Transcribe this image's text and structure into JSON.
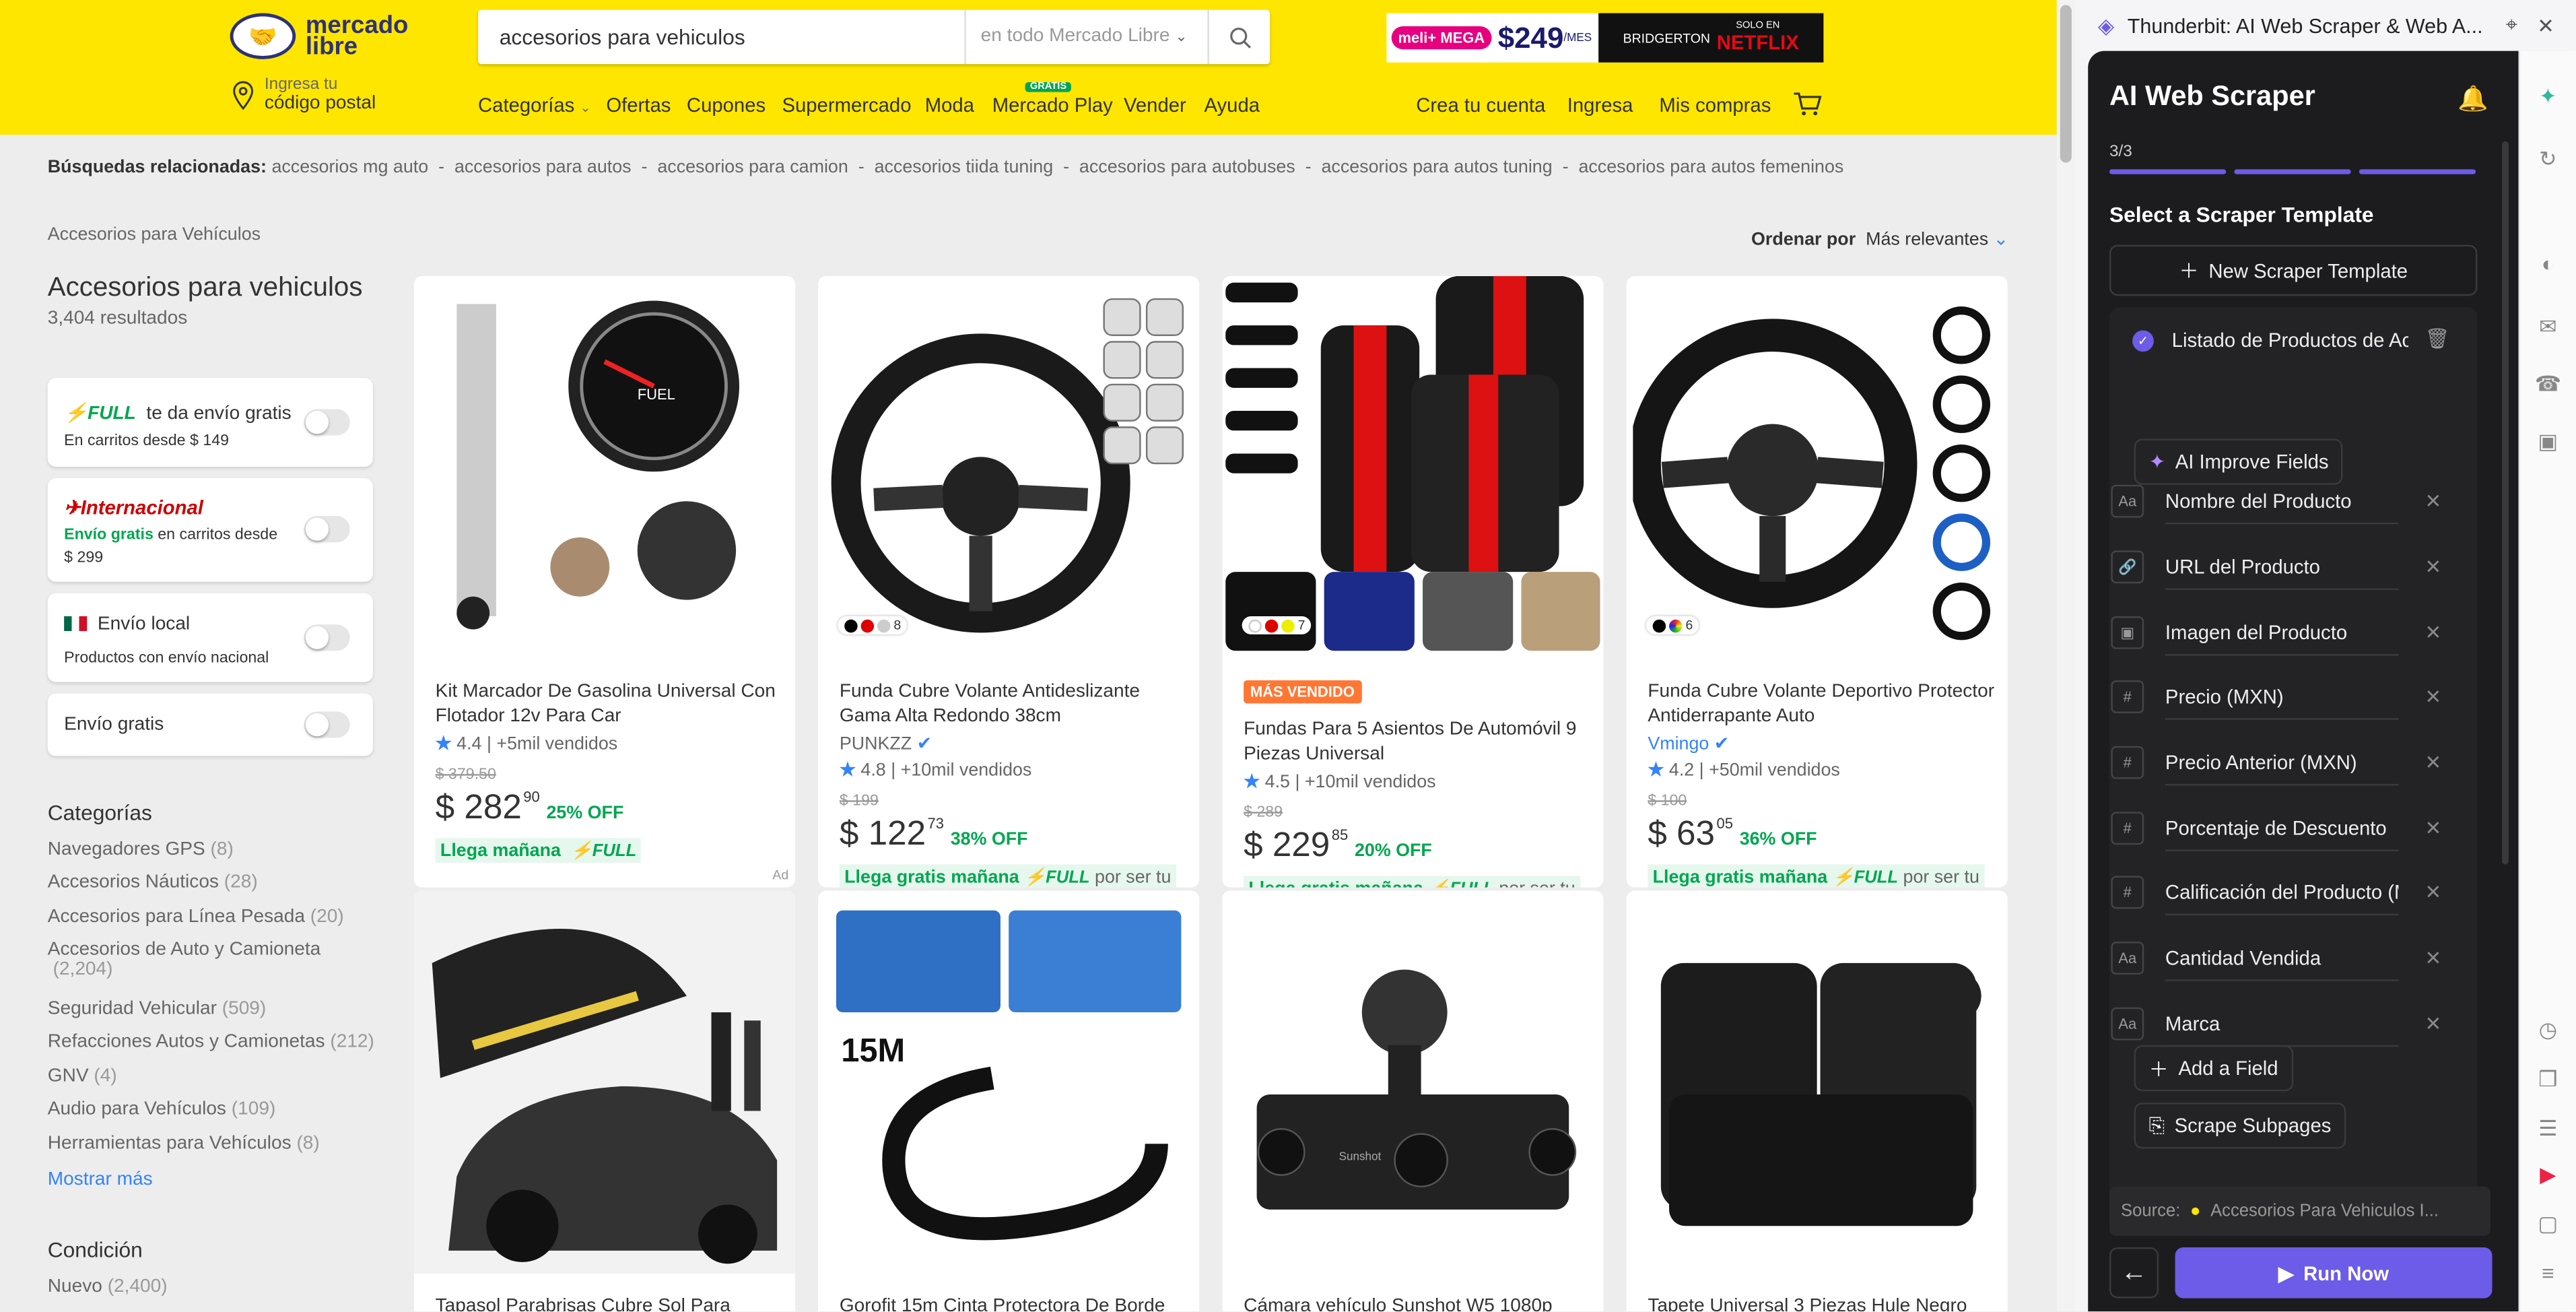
{
  "header": {
    "logo_line1": "mercado",
    "logo_line2": "libre",
    "search_value": "accesorios para vehiculos",
    "search_scope": "en todo Mercado Libre",
    "promo_badge": "meli+ MEGA",
    "promo_price": "$249",
    "promo_unit": "/MES",
    "promo_brand": "BRIDGERTON",
    "promo_solo": "SOLO EN",
    "promo_netflix": "NETFLIX",
    "loc_line1": "Ingresa tu",
    "loc_line2": "código postal",
    "nav": [
      "Categorías",
      "Ofertas",
      "Cupones",
      "Supermercado",
      "Moda",
      "Mercado Play",
      "Vender",
      "Ayuda"
    ],
    "gratis_badge": "GRATIS",
    "account": [
      "Crea tu cuenta",
      "Ingresa",
      "Mis compras"
    ]
  },
  "related": {
    "label": "Búsquedas relacionadas:",
    "items": [
      "accesorios mg auto",
      "accesorios para autos",
      "accesorios para camion",
      "accesorios tiida tuning",
      "accesorios para autobuses",
      "accesorios para autos tuning",
      "accesorios para autos femeninos"
    ]
  },
  "breadcrumb": "Accesorios para Vehículos",
  "sort": {
    "label": "Ordenar por",
    "value": "Más relevantes"
  },
  "results": {
    "title": "Accesorios para vehiculos",
    "count": "3,404 resultados"
  },
  "filters": {
    "full_logo": "FULL",
    "full_text": "te da envío gratis",
    "full_sub": "En carritos desde $ 149",
    "intl_title": "Internacional",
    "intl_green": "Envío gratis",
    "intl_sub": "en carritos desde",
    "intl_amount": "$ 299",
    "local_title": "Envío local",
    "local_sub": "Productos con envío nacional",
    "free_title": "Envío gratis"
  },
  "categories": {
    "title": "Categorías",
    "items": [
      {
        "name": "Navegadores GPS",
        "count": "(8)"
      },
      {
        "name": "Accesorios Náuticos",
        "count": "(28)"
      },
      {
        "name": "Accesorios para Línea Pesada",
        "count": "(20)"
      },
      {
        "name": "Accesorios de Auto y Camioneta",
        "count": "(2,204)"
      },
      {
        "name": "Seguridad Vehicular",
        "count": "(509)"
      },
      {
        "name": "Refacciones Autos y Camionetas",
        "count": "(212)"
      },
      {
        "name": "GNV",
        "count": "(4)"
      },
      {
        "name": "Audio para Vehículos",
        "count": "(109)"
      },
      {
        "name": "Herramientas para Vehículos",
        "count": "(8)"
      }
    ],
    "more": "Mostrar más"
  },
  "condition": {
    "title": "Condición",
    "new": "Nuevo",
    "new_count": "(2,400)"
  },
  "products": [
    {
      "title": "Kit Marcador De Gasolina Universal Con Flotador 12v Para Car",
      "rating": "4.4",
      "sold": "| +5mil vendidos",
      "old": "$ 379.50",
      "price": "$ 282",
      "cents": "90",
      "off": "25% OFF",
      "delivery": "Llega mañana",
      "full": "FULL",
      "ad": "Ad"
    },
    {
      "title": "Funda Cubre Volante Antideslizante Gama Alta Redondo 38cm",
      "brand": "PUNKZZ",
      "rating": "4.8",
      "sold": "| +10mil vendidos",
      "old": "$ 199",
      "price": "$ 122",
      "cents": "73",
      "off": "38% OFF",
      "delivery": "Llega gratis mañana",
      "full": "FULL",
      "extra": "por ser tu",
      "swatch": "8"
    },
    {
      "badge": "MÁS VENDIDO",
      "title": "Fundas Para 5 Asientos De Automóvil 9 Piezas Universal",
      "rating": "4.5",
      "sold": "| +10mil vendidos",
      "old": "$ 289",
      "price": "$ 229",
      "cents": "85",
      "off": "20% OFF",
      "delivery": "Llega gratis mañana",
      "full": "FULL",
      "extra": "por ser tu",
      "swatch": "7"
    },
    {
      "title": "Funda Cubre Volante Deportivo Protector Antiderrapante Auto",
      "brand": "Vmingo",
      "rating": "4.2",
      "sold": "| +50mil vendidos",
      "old": "$ 100",
      "price": "$ 63",
      "cents": "05",
      "off": "36% OFF",
      "delivery": "Llega gratis mañana",
      "full": "FULL",
      "extra": "por ser tu",
      "swatch": "6"
    },
    {
      "title": "Tapasol Parabrisas Cubre Sol Para"
    },
    {
      "title": "Gorofit 15m Cinta Protectora De Borde",
      "img_text": "15M"
    },
    {
      "title": "Cámara vehículo Sunshot W5 1080p",
      "img_text": "Sunshot"
    },
    {
      "title": "Tapete Universal 3 Piezas Hule Negro"
    }
  ],
  "extension": {
    "tab_title": "Thunderbit: AI Web Scraper & Web A...",
    "title": "AI Web Scraper",
    "step": "3/3",
    "section": "Select a Scraper Template",
    "new_template": "New Scraper Template",
    "template_name": "Listado de Productos de Acc",
    "improve": "AI Improve Fields",
    "fields": [
      {
        "name": "Nombre del Producto",
        "icon": "Aa"
      },
      {
        "name": "URL del Producto",
        "icon": "🔗"
      },
      {
        "name": "Imagen del Producto",
        "icon": "▣"
      },
      {
        "name": "Precio (MXN)",
        "icon": "#"
      },
      {
        "name": "Precio Anterior (MXN)",
        "icon": "#"
      },
      {
        "name": "Porcentaje de Descuento",
        "icon": "#"
      },
      {
        "name": "Calificación del Producto (M",
        "icon": "#"
      },
      {
        "name": "Cantidad Vendida",
        "icon": "Aa"
      },
      {
        "name": "Marca",
        "icon": "Aa"
      }
    ],
    "add_field": "Add a Field",
    "subpages": "Scrape Subpages",
    "source_label": "Source:",
    "source_value": "Accesorios Para Vehiculos I...",
    "run": "Run Now",
    "accent": "#6c5ce7"
  }
}
